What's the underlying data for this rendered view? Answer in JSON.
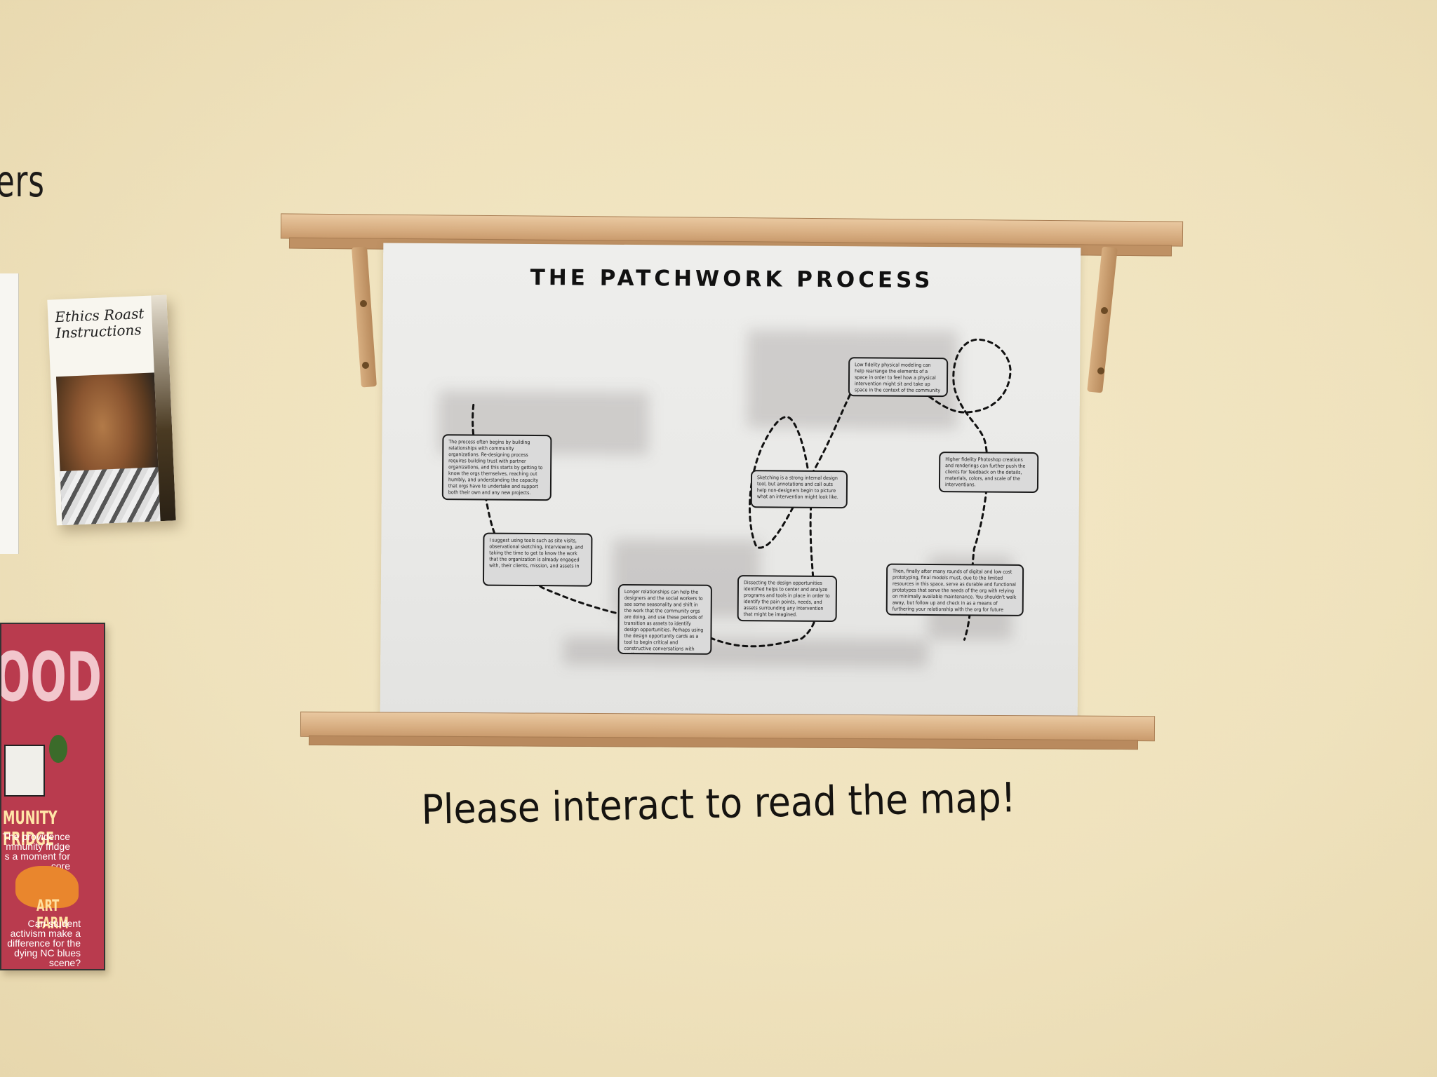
{
  "wall": {
    "partial_heading": "ers",
    "instruction": "Please interact to read the map!"
  },
  "brochure": {
    "title": "Ethics Roast Instructions"
  },
  "zine": {
    "headline": "OOD",
    "fridge_title": "MUNITY FRIDGE",
    "fridge_text": "The providence mmunity fridge s a moment for core",
    "farm_title": "ART FARM",
    "farm_text": "Can student activism make a difference for the dying NC blues scene?"
  },
  "poster": {
    "title": "THE PATCHWORK PROCESS",
    "boxes": [
      {
        "name": "box-relationships",
        "text": "The process often begins by building relationships with community organizations. Re-designing process requires building trust with partner organizations, and this starts by getting to know the orgs themselves, reaching out humbly, and understanding the capacity that orgs have to undertake and support both their own and any new projects."
      },
      {
        "name": "box-tools",
        "text": "I suggest using tools such as site visits, observational sketching, interviewing, and taking the time to get to know the work that the organization is already engaged with, their clients, mission, and assets in"
      },
      {
        "name": "box-longer-relationships",
        "text": "Longer relationships can help the designers and the social workers to see some seasonality and shift in the work that the community orgs are doing, and use these periods of transition as assets to identify design opportunities. Perhaps using the design opportunity cards as a tool to begin critical and constructive conversations with staff and clients."
      },
      {
        "name": "box-dissecting",
        "text": "Dissecting the design opportunities identified helps to center and analyze programs and tools in place in order to identify the pain points, needs, and assets surrounding any intervention that might be imagined."
      },
      {
        "name": "box-sketching",
        "text": "Sketching is a strong internal design tool, but annotations and call outs help non-designers begin to picture what an intervention might look like."
      },
      {
        "name": "box-low-fidelity",
        "text": "Low fidelity physical modeling can help rearrange the elements of a space in order to feel how a physical intervention might sit and take up space in the context of the community org."
      },
      {
        "name": "box-higher-fidelity",
        "text": "Higher fidelity Photoshop creations and renderings can further push the clients for feedback on the details, materials, colors, and scale of the interventions."
      },
      {
        "name": "box-final",
        "text": "Then, finally after many rounds of digital and low cost prototyping, final models must, due to the limited resources in this space, serve as durable and functional prototypes that serve the needs of the org with relying on minimally available maintenance. You shouldn't walk away, but follow up and check in as a means of furthering your relationship with the org for future projects."
      }
    ]
  }
}
